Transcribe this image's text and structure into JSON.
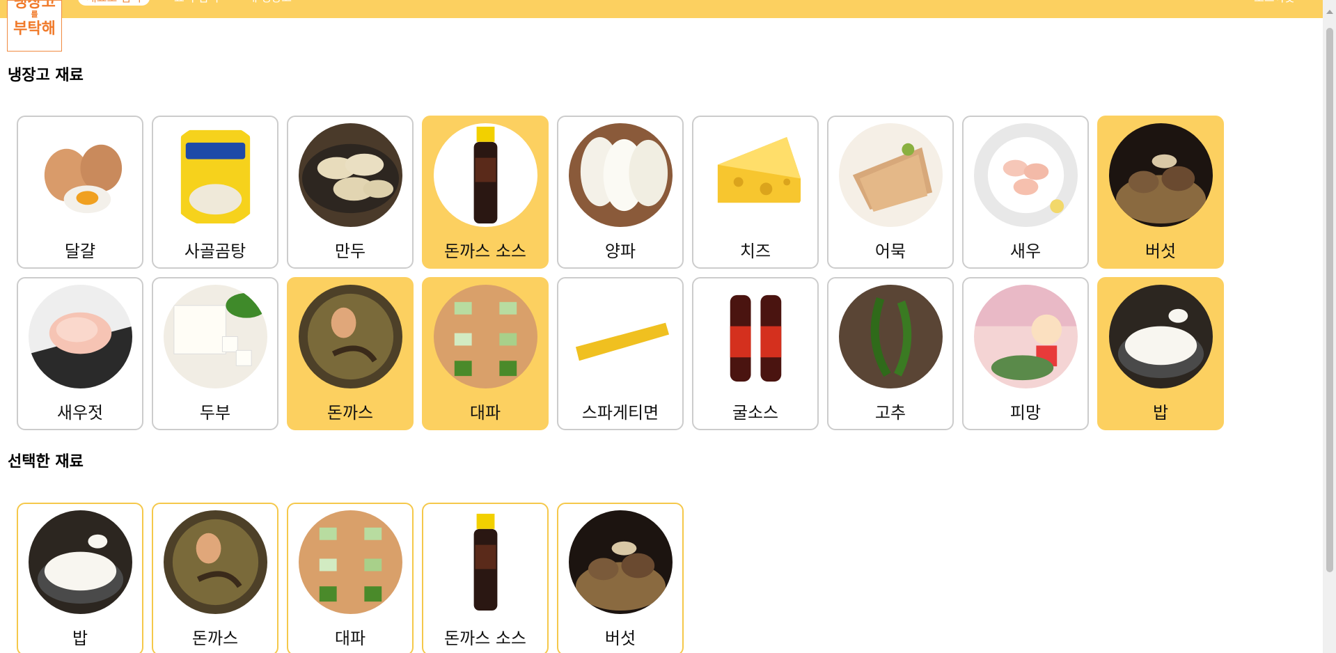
{
  "header": {
    "logo": {
      "line1": "냉장고",
      "line2": "를",
      "line3": "부탁해"
    },
    "nav_active": "재료로 검색",
    "nav_links": [
      "요리 검색",
      "내 냉장고"
    ],
    "nav_right": "로그아웃"
  },
  "fridge": {
    "title": "냉장고 재료",
    "items": [
      {
        "name": "달걀",
        "selected": false,
        "icon": "egg-image"
      },
      {
        "name": "사골곰탕",
        "selected": false,
        "icon": "bone-broth-pack-image"
      },
      {
        "name": "만두",
        "selected": false,
        "icon": "dumplings-image"
      },
      {
        "name": "돈까스 소스",
        "selected": true,
        "icon": "sauce-bottle-image"
      },
      {
        "name": "양파",
        "selected": false,
        "icon": "onion-image"
      },
      {
        "name": "치즈",
        "selected": false,
        "icon": "cheese-image"
      },
      {
        "name": "어묵",
        "selected": false,
        "icon": "fishcake-image"
      },
      {
        "name": "새우",
        "selected": false,
        "icon": "shrimp-image"
      },
      {
        "name": "버섯",
        "selected": true,
        "icon": "mushroom-image"
      },
      {
        "name": "새우젓",
        "selected": false,
        "icon": "salted-shrimp-image"
      },
      {
        "name": "두부",
        "selected": false,
        "icon": "tofu-image"
      },
      {
        "name": "돈까스",
        "selected": true,
        "icon": "pork-cutlet-image"
      },
      {
        "name": "대파",
        "selected": true,
        "icon": "green-onion-image"
      },
      {
        "name": "스파게티면",
        "selected": false,
        "icon": "spaghetti-image"
      },
      {
        "name": "굴소스",
        "selected": false,
        "icon": "oyster-sauce-image"
      },
      {
        "name": "고추",
        "selected": false,
        "icon": "chili-pepper-image"
      },
      {
        "name": "피망",
        "selected": false,
        "icon": "bell-pepper-image"
      },
      {
        "name": "밥",
        "selected": true,
        "icon": "rice-image"
      }
    ]
  },
  "selected": {
    "title": "선택한 재료",
    "items": [
      {
        "name": "밥",
        "icon": "rice-image"
      },
      {
        "name": "돈까스",
        "icon": "pork-cutlet-image"
      },
      {
        "name": "대파",
        "icon": "green-onion-image"
      },
      {
        "name": "돈까스 소스",
        "icon": "sauce-bottle-image"
      },
      {
        "name": "버섯",
        "icon": "mushroom-image"
      }
    ]
  },
  "colors": {
    "accent": "#fcd060",
    "logo": "#f07a2a",
    "border": "#cccccc"
  }
}
